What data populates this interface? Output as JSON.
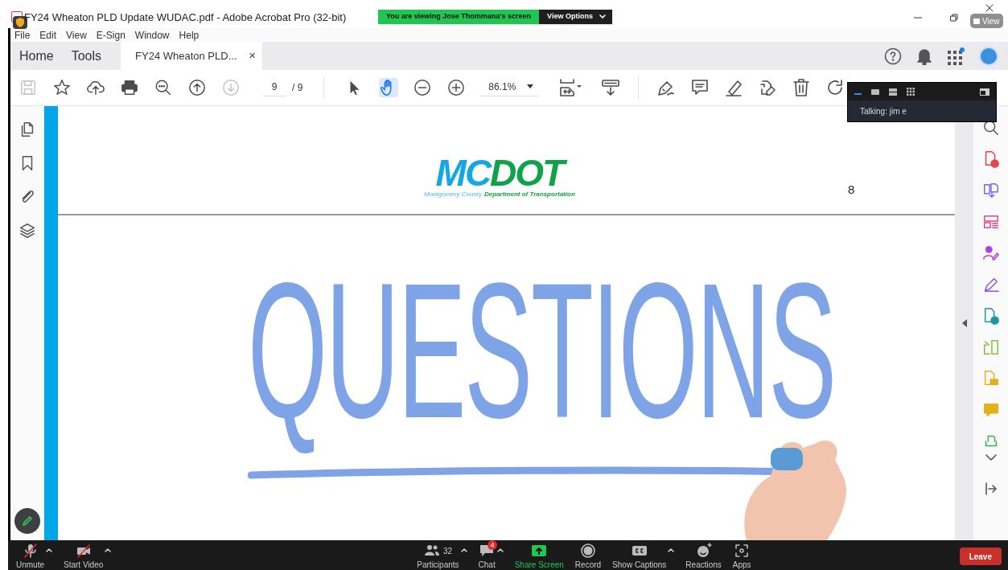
{
  "window": {
    "title": "FY24 Wheaton PLD Update WUDAC.pdf - Adobe Acrobat Pro (32-bit)",
    "view_button": "View"
  },
  "share_banner": {
    "text": "You are viewing Jose Thommana's screen",
    "options": "View Options"
  },
  "menu": [
    "File",
    "Edit",
    "View",
    "E-Sign",
    "Window",
    "Help"
  ],
  "tabs": [
    {
      "label": "Home",
      "selected": false,
      "closable": false
    },
    {
      "label": "Tools",
      "selected": false,
      "closable": false
    },
    {
      "label": "FY24 Wheaton PLD...",
      "selected": true,
      "closable": true,
      "close": "×"
    }
  ],
  "toolbar": {
    "left_tools": [
      {
        "disabled": true,
        "selected": false
      },
      {
        "disabled": false,
        "selected": false
      },
      {
        "disabled": false,
        "selected": false
      },
      {
        "disabled": false,
        "selected": false
      },
      {
        "disabled": false,
        "selected": false
      },
      {
        "disabled": false,
        "selected": false
      },
      {
        "disabled": true,
        "selected": false
      }
    ],
    "page": {
      "current": "9",
      "total": "/ 9"
    },
    "mid_tools": [
      {
        "disabled": false,
        "selected": false
      },
      {
        "disabled": false,
        "selected": true
      },
      {
        "disabled": false,
        "selected": false
      },
      {
        "disabled": false,
        "selected": false
      }
    ],
    "zoom": "86.1%"
  },
  "video_panel": {
    "talking": "Talking: jim e"
  },
  "slide": {
    "logo": "MCDOT",
    "logo_sub_1": "Montgomery County",
    "logo_sub_2": "Department of Transportation",
    "page_number": "8",
    "headline": "QUESTIONS"
  },
  "bottom_bar": {
    "items": [
      {
        "label": "Unmute",
        "kind": "mic",
        "caret": true
      },
      {
        "label": "Start Video",
        "kind": "video",
        "caret": true
      },
      {
        "label": "Participants",
        "kind": "participants",
        "count": "32",
        "caret": true
      },
      {
        "label": "Chat",
        "kind": "chat",
        "badge": "4",
        "caret": true
      },
      {
        "label": "Share Screen",
        "kind": "share",
        "caret": false
      },
      {
        "label": "Record",
        "kind": "record",
        "caret": false
      },
      {
        "label": "Show Captions",
        "kind": "captions",
        "caret": true
      },
      {
        "label": "Reactions",
        "kind": "reactions",
        "caret": false
      },
      {
        "label": "Apps",
        "kind": "apps",
        "caret": false
      }
    ],
    "leave": "Leave"
  }
}
